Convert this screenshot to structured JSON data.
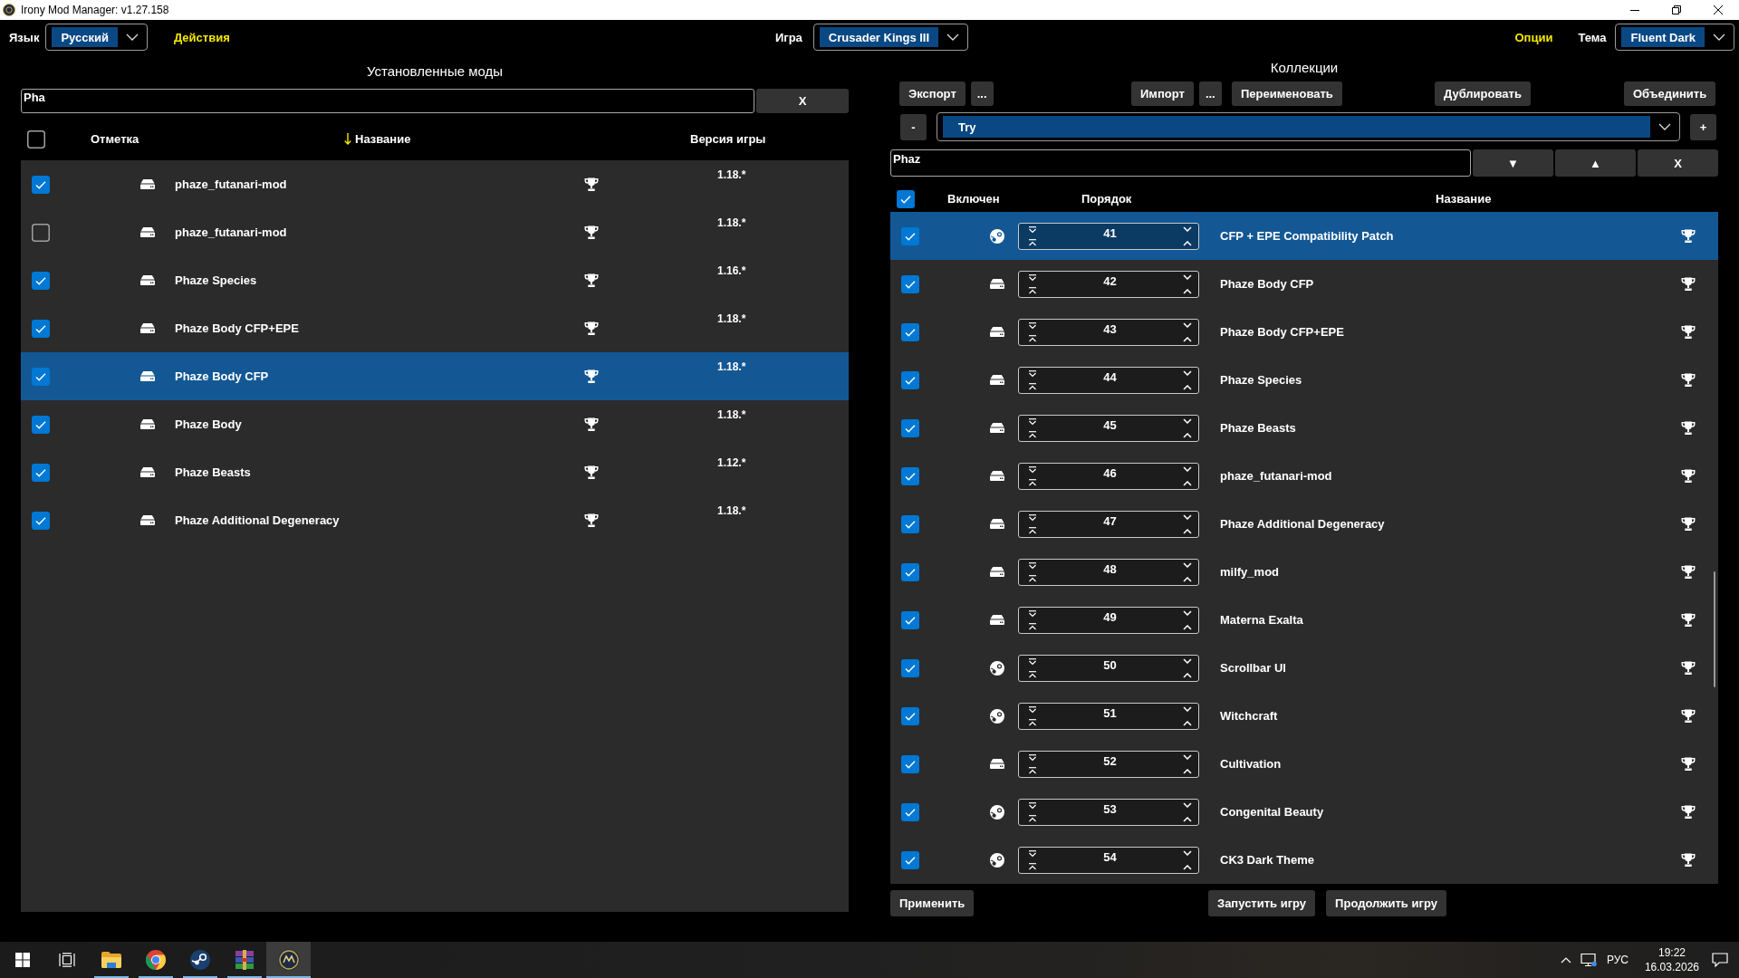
{
  "window": {
    "title": "Irony Mod Manager: v1.27.158"
  },
  "top_bar": {
    "language_label": "Язык",
    "language": "Русский",
    "actions_menu": "Действия",
    "game_label": "Игра",
    "game": "Crusader Kings III",
    "options_menu": "Опции",
    "theme_label": "Тема",
    "theme": "Fluent Dark"
  },
  "installed_mods": {
    "title": "Установленные моды",
    "search": {
      "value": "Pha"
    },
    "clear_button": "X",
    "select_all": {
      "checked": false
    },
    "columns": [
      {
        "label": "Отметка",
        "sorted": false
      },
      {
        "label": "Название",
        "sorted": true
      },
      {
        "label": "Версия игры",
        "sorted": false
      }
    ],
    "rows": [
      {
        "checked": true,
        "kind": "local",
        "name": "phaze_futanari-mod",
        "version": "1.18.*",
        "selected": false
      },
      {
        "checked": false,
        "kind": "local",
        "name": "phaze_futanari-mod",
        "version": "1.18.*",
        "selected": false
      },
      {
        "checked": true,
        "kind": "local",
        "name": "Phaze Species",
        "version": "1.16.*",
        "selected": false
      },
      {
        "checked": true,
        "kind": "local",
        "name": "Phaze Body CFP+EPE",
        "version": "1.18.*",
        "selected": false
      },
      {
        "checked": true,
        "kind": "local",
        "name": "Phaze Body CFP",
        "version": "1.18.*",
        "selected": true
      },
      {
        "checked": true,
        "kind": "local",
        "name": "Phaze Body",
        "version": "1.18.*",
        "selected": false
      },
      {
        "checked": true,
        "kind": "local",
        "name": "Phaze Beasts",
        "version": "1.12.*",
        "selected": false
      },
      {
        "checked": true,
        "kind": "local",
        "name": "Phaze Additional Degeneracy",
        "version": "1.18.*",
        "selected": false
      }
    ]
  },
  "collections": {
    "title": "Коллекции",
    "toolbar": [
      [
        "Экспорт",
        "..."
      ],
      [
        "Импорт",
        "..."
      ],
      [
        "Переименовать"
      ],
      [
        "Дублировать"
      ],
      [
        "Объединить"
      ]
    ],
    "remove_button": "-",
    "collection": "Try",
    "add_button": "+",
    "search": {
      "value": "Phaz"
    },
    "search_buttons": [
      "▼",
      "▲",
      "X"
    ],
    "select_all": {
      "checked": true
    },
    "columns": [
      {
        "label": "Включен",
        "sorted": false
      },
      {
        "label": "Порядок",
        "sorted": false
      },
      {
        "label": "Название",
        "sorted": false
      }
    ],
    "rows": [
      {
        "checked": true,
        "kind": "steam",
        "order": "41",
        "name": "CFP + EPE Compatibility Patch",
        "selected": true
      },
      {
        "checked": true,
        "kind": "local",
        "order": "42",
        "name": "Phaze Body CFP",
        "selected": false
      },
      {
        "checked": true,
        "kind": "local",
        "order": "43",
        "name": "Phaze Body CFP+EPE",
        "selected": false
      },
      {
        "checked": true,
        "kind": "local",
        "order": "44",
        "name": "Phaze Species",
        "selected": false
      },
      {
        "checked": true,
        "kind": "local",
        "order": "45",
        "name": "Phaze Beasts",
        "selected": false
      },
      {
        "checked": true,
        "kind": "local",
        "order": "46",
        "name": "phaze_futanari-mod",
        "selected": false
      },
      {
        "checked": true,
        "kind": "local",
        "order": "47",
        "name": "Phaze Additional Degeneracy",
        "selected": false
      },
      {
        "checked": true,
        "kind": "local",
        "order": "48",
        "name": "milfy_mod",
        "selected": false
      },
      {
        "checked": true,
        "kind": "local",
        "order": "49",
        "name": "Materna Exalta",
        "selected": false
      },
      {
        "checked": true,
        "kind": "steam",
        "order": "50",
        "name": "Scrollbar UI",
        "selected": false
      },
      {
        "checked": true,
        "kind": "steam",
        "order": "51",
        "name": "Witchcraft",
        "selected": false
      },
      {
        "checked": true,
        "kind": "local",
        "order": "52",
        "name": "Cultivation",
        "selected": false
      },
      {
        "checked": true,
        "kind": "steam",
        "order": "53",
        "name": "Congenital Beauty",
        "selected": false
      },
      {
        "checked": true,
        "kind": "steam",
        "order": "54",
        "name": "CK3 Dark Theme",
        "selected": false
      }
    ],
    "footer_buttons": [
      "Применить",
      "Запустить игру",
      "Продолжить игру"
    ]
  },
  "taskbar": {
    "buttons": [
      {
        "kind": "start"
      },
      {
        "kind": "task-view"
      }
    ],
    "apps": [
      {
        "kind": "folder",
        "running": true,
        "selected": false
      },
      {
        "kind": "browser",
        "running": true,
        "selected": false
      },
      {
        "kind": "game-store",
        "running": true,
        "selected": false
      },
      {
        "kind": "archiver",
        "running": true,
        "selected": false
      },
      {
        "kind": "mod-manager",
        "running": true,
        "selected": true
      }
    ],
    "tray": {
      "input_language": "РУС",
      "time": "19:22",
      "date": "16.03.2026"
    }
  }
}
